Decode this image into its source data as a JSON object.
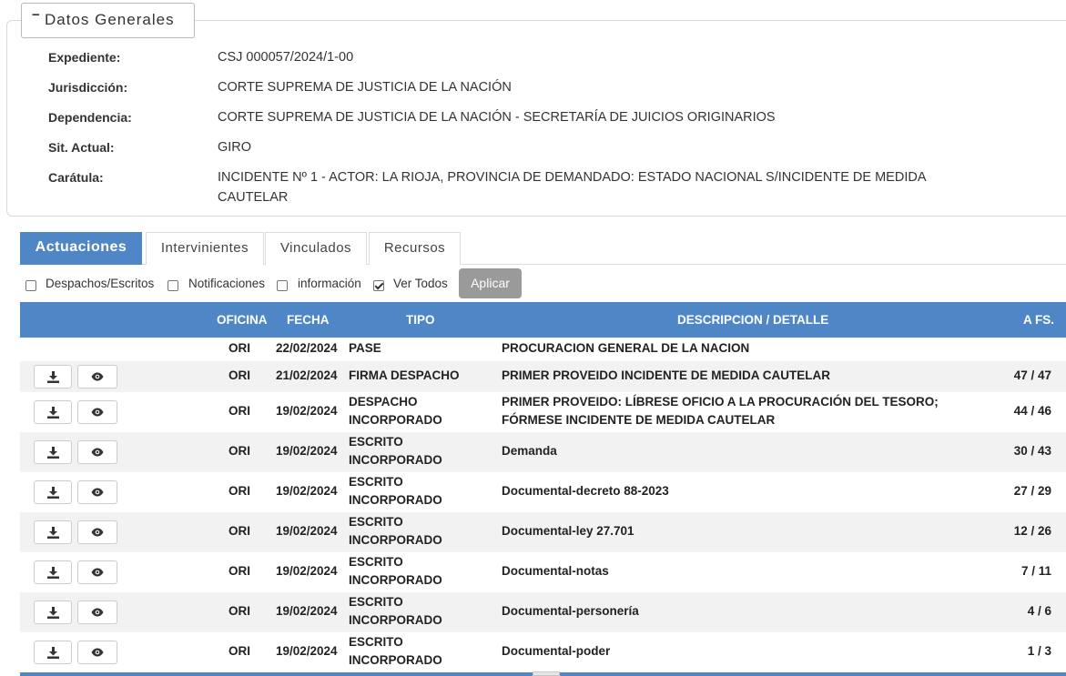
{
  "datos": {
    "legend": "Datos Generales",
    "toggle": "−",
    "fields": [
      {
        "label": "Expediente:",
        "value": "CSJ 000057/2024/1-00"
      },
      {
        "label": "Jurisdicción:",
        "value": "CORTE SUPREMA DE JUSTICIA DE LA NACIÓN"
      },
      {
        "label": "Dependencia:",
        "value": "CORTE SUPREMA DE JUSTICIA DE LA NACIÓN - SECRETARÍA DE JUICIOS ORIGINARIOS"
      },
      {
        "label": "Sit. Actual:",
        "value": "GIRO"
      },
      {
        "label": "Carátula:",
        "value": "INCIDENTE Nº 1 - ACTOR: LA RIOJA, PROVINCIA DE DEMANDADO: ESTADO NACIONAL S/INCIDENTE DE MEDIDA CAUTELAR"
      }
    ]
  },
  "tabs": [
    {
      "label": "Actuaciones"
    },
    {
      "label": "Intervinientes"
    },
    {
      "label": "Vinculados"
    },
    {
      "label": "Recursos"
    }
  ],
  "filters": [
    {
      "label": "Despachos/Escritos",
      "checked": false
    },
    {
      "label": "Notificaciones",
      "checked": false
    },
    {
      "label": "información",
      "checked": false
    },
    {
      "label": "Ver Todos",
      "checked": true
    }
  ],
  "apply_label": "Aplicar",
  "table": {
    "headers": {
      "oficina": "OFICINA",
      "fecha": "FECHA",
      "tipo": "TIPO",
      "descripcion": "DESCRIPCION / DETALLE",
      "afs": "A FS."
    },
    "rows": [
      {
        "oficina": "ORI",
        "fecha": "22/02/2024",
        "tipo1": "PASE",
        "tipo2": "",
        "desc1": "PROCURACION GENERAL DE LA NACION",
        "desc2": "",
        "afs": "",
        "buttons": false
      },
      {
        "oficina": "ORI",
        "fecha": "21/02/2024",
        "tipo1": "FIRMA DESPACHO",
        "tipo2": "",
        "desc1": "PRIMER PROVEIDO INCIDENTE DE MEDIDA CAUTELAR",
        "desc2": "",
        "afs": "47 / 47",
        "buttons": true
      },
      {
        "oficina": "ORI",
        "fecha": "19/02/2024",
        "tipo1": "DESPACHO",
        "tipo2": "INCORPORADO",
        "desc1": "PRIMER PROVEIDO: LÍBRESE OFICIO A LA PROCURACIÓN DEL TESORO;",
        "desc2": "FÓRMESE INCIDENTE DE MEDIDA CAUTELAR",
        "afs": "44 / 46",
        "buttons": true
      },
      {
        "oficina": "ORI",
        "fecha": "19/02/2024",
        "tipo1": "ESCRITO",
        "tipo2": "INCORPORADO",
        "desc1": "Demanda",
        "desc2": "",
        "afs": "30 / 43",
        "buttons": true
      },
      {
        "oficina": "ORI",
        "fecha": "19/02/2024",
        "tipo1": "ESCRITO",
        "tipo2": "INCORPORADO",
        "desc1": "Documental-decreto 88-2023",
        "desc2": "",
        "afs": "27 / 29",
        "buttons": true
      },
      {
        "oficina": "ORI",
        "fecha": "19/02/2024",
        "tipo1": "ESCRITO",
        "tipo2": "INCORPORADO",
        "desc1": "Documental-ley 27.701",
        "desc2": "",
        "afs": "12 / 26",
        "buttons": true
      },
      {
        "oficina": "ORI",
        "fecha": "19/02/2024",
        "tipo1": "ESCRITO",
        "tipo2": "INCORPORADO",
        "desc1": "Documental-notas",
        "desc2": "",
        "afs": "7 / 11",
        "buttons": true
      },
      {
        "oficina": "ORI",
        "fecha": "19/02/2024",
        "tipo1": "ESCRITO",
        "tipo2": "INCORPORADO",
        "desc1": "Documental-personería",
        "desc2": "",
        "afs": "4 / 6",
        "buttons": true
      },
      {
        "oficina": "ORI",
        "fecha": "19/02/2024",
        "tipo1": "ESCRITO",
        "tipo2": "INCORPORADO",
        "desc1": "Documental-poder",
        "desc2": "",
        "afs": "1 / 3",
        "buttons": true
      }
    ]
  },
  "colors": {
    "accent": "#4f86c6",
    "apply_button": "#9a9a9a",
    "row_alt": "#f2f2f2"
  }
}
